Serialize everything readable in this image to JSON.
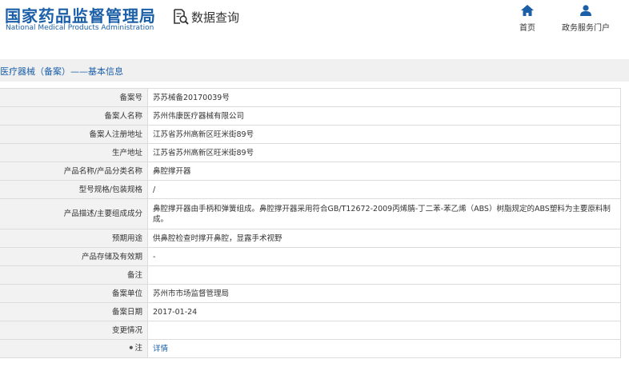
{
  "header": {
    "logo_cn": "国家药品监督管理局",
    "logo_en": "National Medical Products Administration",
    "query_label": "数据查询",
    "nav": [
      {
        "label": "首页",
        "icon": "home-icon"
      },
      {
        "label": "政务服务门户",
        "icon": "user-icon"
      }
    ]
  },
  "breadcrumb": "医疗器械（备案）——基本信息",
  "rows": [
    {
      "label": "备案号",
      "value": "苏苏械备20170039号"
    },
    {
      "label": "备案人名称",
      "value": "苏州伟康医疗器械有限公司"
    },
    {
      "label": "备案人注册地址",
      "value": "江苏省苏州高新区旺米街89号"
    },
    {
      "label": "生产地址",
      "value": "江苏省苏州高新区旺米街89号"
    },
    {
      "label": "产品名称/产品分类名称",
      "value": "鼻腔撑开器"
    },
    {
      "label": "型号规格/包装规格",
      "value": "/"
    },
    {
      "label": "产品描述/主要组成成分",
      "value": "鼻腔撑开器由手柄和弹簧组成。鼻腔撑开器采用符合GB/T12672-2009丙烯腈-丁二苯-苯乙烯（ABS）树脂规定的ABS塑料为主要原料制成。"
    },
    {
      "label": "预期用途",
      "value": "供鼻腔检查时撑开鼻腔，显露手术视野"
    },
    {
      "label": "产品存储及有效期",
      "value": "-"
    },
    {
      "label": "备注",
      "value": ""
    },
    {
      "label": "备案单位",
      "value": "苏州市市场监督管理局"
    },
    {
      "label": "备案日期",
      "value": "2017-01-24"
    },
    {
      "label": "变更情况",
      "value": ""
    },
    {
      "label": "注",
      "value": "详情"
    }
  ],
  "colors": {
    "brand": "#1b5fa8",
    "label_bg": "#f2f2f2",
    "border": "#dcdcdc",
    "crumb_bg": "#f0f0f0"
  }
}
